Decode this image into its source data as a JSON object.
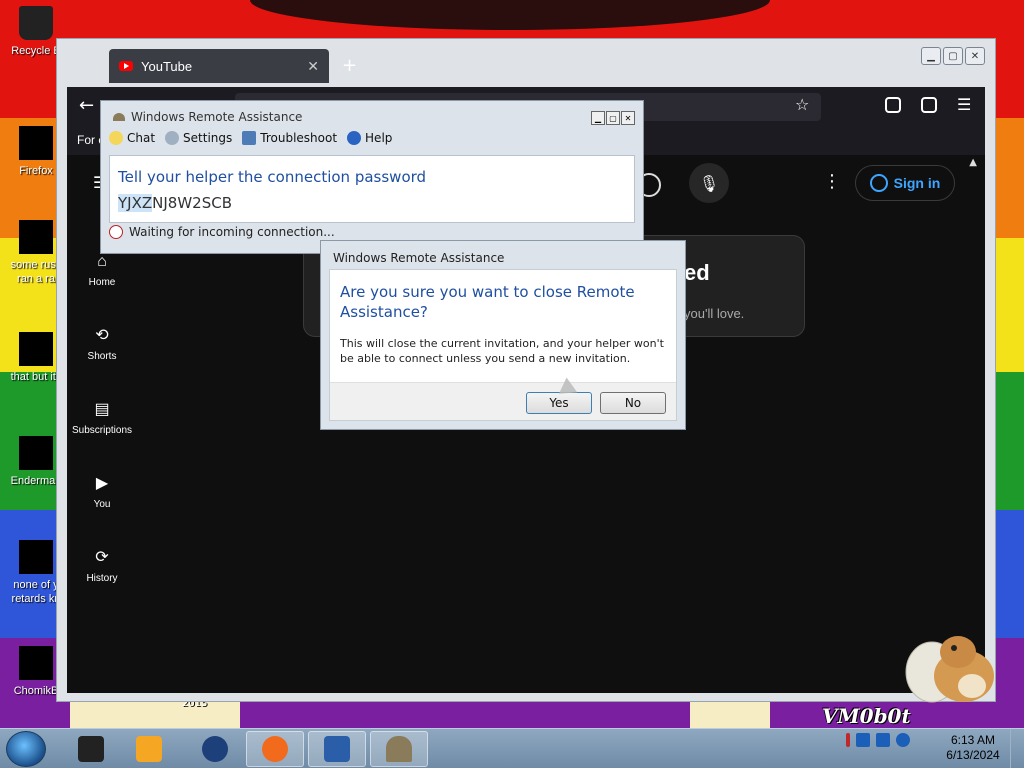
{
  "desktop": {
    "icons": [
      {
        "label": "Recycle B"
      },
      {
        "label": "Firefox"
      },
      {
        "label": "some russ\nran a ra"
      },
      {
        "label": "that but its"
      },
      {
        "label": "Enderman"
      },
      {
        "label": "none of y\nretards kn"
      },
      {
        "label": "ChomikB"
      }
    ],
    "wallpaper_text": "VM0b0t",
    "wallpaper_year": "2015"
  },
  "browser": {
    "tab_title": "YouTube",
    "tab_close": "✕",
    "new_tab": "+",
    "bookmark_text": "For c",
    "window_buttons": [
      "▁",
      "▢",
      "✕"
    ],
    "youtube": {
      "sign_in": "Sign in",
      "promo_title": "ed",
      "promo_sub": "you'll love.",
      "nav": [
        {
          "label": "Home",
          "icon": "home-icon",
          "glyph": "⌂"
        },
        {
          "label": "Shorts",
          "icon": "shorts-icon",
          "glyph": "⟲"
        },
        {
          "label": "Subscriptions",
          "icon": "subscriptions-icon",
          "glyph": "▤"
        },
        {
          "label": "You",
          "icon": "you-icon",
          "glyph": "▶"
        },
        {
          "label": "History",
          "icon": "history-icon",
          "glyph": "⟳"
        }
      ]
    }
  },
  "remote_assistance": {
    "title": "Windows Remote Assistance",
    "menu": {
      "chat": "Chat",
      "settings": "Settings",
      "troubleshoot": "Troubleshoot",
      "help": "Help"
    },
    "heading": "Tell your helper the connection password",
    "password_selected": "YJXZ",
    "password_rest": "NJ8W2SCB",
    "status": "Waiting for incoming connection..."
  },
  "confirm_dialog": {
    "title": "Windows Remote Assistance",
    "question": "Are you sure you want to close Remote Assistance?",
    "message": "This will close the current invitation, and your helper won't be able to connect unless you send a new invitation.",
    "yes": "Yes",
    "no": "No"
  },
  "taskbar": {
    "time": "6:13 AM",
    "date": "6/13/2024"
  },
  "colors": {
    "link_blue": "#1f4fa1",
    "youtube_red": "#ff0000",
    "signin_blue": "#3ea6ff"
  }
}
